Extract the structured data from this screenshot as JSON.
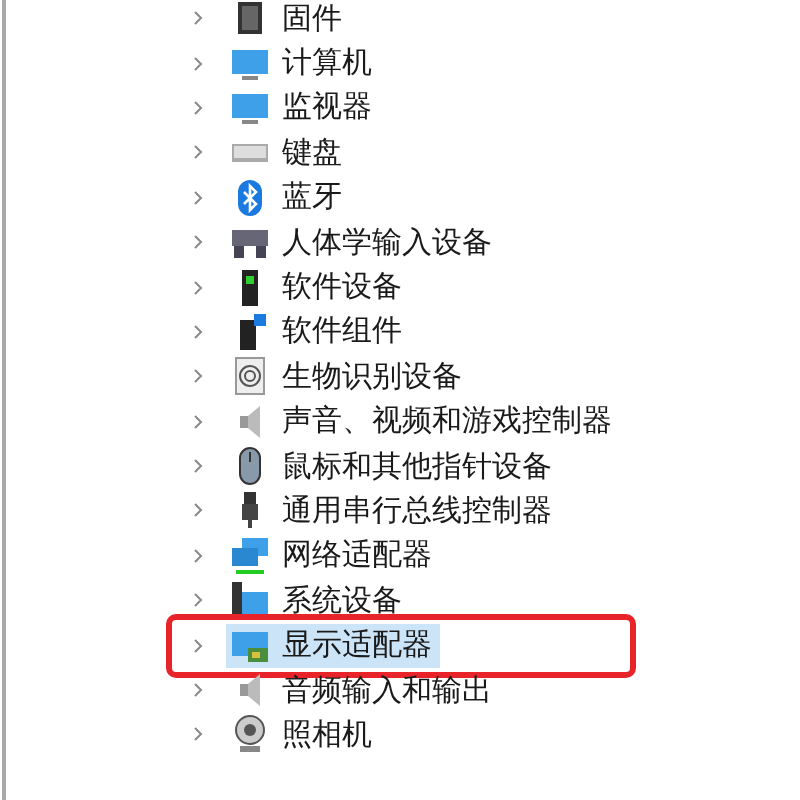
{
  "tree": {
    "items": [
      {
        "label": "固件",
        "expanded": false,
        "selected": false,
        "marked": false
      },
      {
        "label": "计算机",
        "expanded": false,
        "selected": false,
        "marked": false
      },
      {
        "label": "监视器",
        "expanded": false,
        "selected": false,
        "marked": false
      },
      {
        "label": "键盘",
        "expanded": false,
        "selected": false,
        "marked": false
      },
      {
        "label": "蓝牙",
        "expanded": false,
        "selected": false,
        "marked": false
      },
      {
        "label": "人体学输入设备",
        "expanded": false,
        "selected": false,
        "marked": false
      },
      {
        "label": "软件设备",
        "expanded": false,
        "selected": false,
        "marked": false
      },
      {
        "label": "软件组件",
        "expanded": false,
        "selected": false,
        "marked": false
      },
      {
        "label": "生物识别设备",
        "expanded": false,
        "selected": false,
        "marked": false
      },
      {
        "label": "声音、视频和游戏控制器",
        "expanded": false,
        "selected": false,
        "marked": false
      },
      {
        "label": "鼠标和其他指针设备",
        "expanded": false,
        "selected": false,
        "marked": false
      },
      {
        "label": "通用串行总线控制器",
        "expanded": false,
        "selected": false,
        "marked": false
      },
      {
        "label": "网络适配器",
        "expanded": false,
        "selected": false,
        "marked": false
      },
      {
        "label": "系统设备",
        "expanded": false,
        "selected": false,
        "marked": false
      },
      {
        "label": "显示适配器",
        "expanded": false,
        "selected": true,
        "marked": true
      },
      {
        "label": "音频输入和输出",
        "expanded": false,
        "selected": false,
        "marked": false
      },
      {
        "label": "照相机",
        "expanded": false,
        "selected": false,
        "marked": false
      }
    ]
  }
}
